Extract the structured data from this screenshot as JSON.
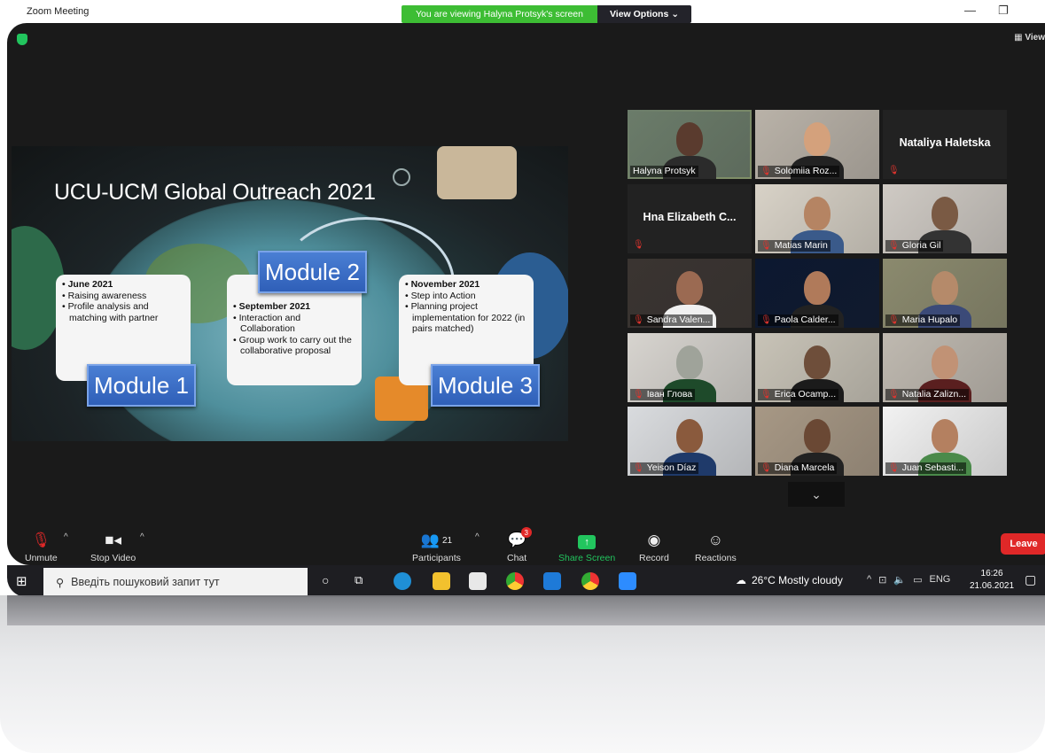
{
  "window": {
    "title": "Zoom Meeting",
    "viewing_banner": "You are viewing Halyna Protsyk's screen",
    "view_options": "View Options ⌄",
    "view_button": "View"
  },
  "slide": {
    "title": "UCU-UCM Global Outreach 2021",
    "boxes": [
      {
        "heading": "June 2021",
        "items": [
          "Raising awareness",
          "Profile analysis and matching with partner"
        ]
      },
      {
        "heading": "September 2021",
        "items": [
          "Interaction and Collaboration",
          "Group work to carry out the collaborative proposal"
        ]
      },
      {
        "heading": "November 2021",
        "items": [
          "Step into Action",
          "Planning project implementation for 2022 (in pairs matched)"
        ]
      }
    ],
    "modules": [
      "Module 1",
      "Module 2",
      "Module 3"
    ]
  },
  "participants_tiles": [
    {
      "name": "Halyna Protsyk",
      "muted": false,
      "video": true,
      "active": true
    },
    {
      "name": "Solomiia Roz...",
      "muted": true,
      "video": true
    },
    {
      "name": "Nataliya Haletska",
      "muted": true,
      "video": false
    },
    {
      "name": "Hna  Elizabeth C...",
      "muted": true,
      "video": false
    },
    {
      "name": "Matias Marin",
      "muted": true,
      "video": true
    },
    {
      "name": "Gloria Gil",
      "muted": true,
      "video": true
    },
    {
      "name": "Sandra Valen...",
      "muted": true,
      "video": true
    },
    {
      "name": "Paola Calder...",
      "muted": true,
      "video": true
    },
    {
      "name": "Maria Hupalo",
      "muted": true,
      "video": true
    },
    {
      "name": "Іван Глова",
      "muted": true,
      "video": true
    },
    {
      "name": "Erica Ocamp...",
      "muted": true,
      "video": true
    },
    {
      "name": "Natalia Zalizn...",
      "muted": true,
      "video": true
    },
    {
      "name": "Yeison Díaz",
      "muted": true,
      "video": true
    },
    {
      "name": "Diana Marcela",
      "muted": true,
      "video": true
    },
    {
      "name": "Juan Sebasti...",
      "muted": true,
      "video": true
    }
  ],
  "toolbar": {
    "unmute": "Unmute",
    "stop_video": "Stop Video",
    "participants": "Participants",
    "participants_count": "21",
    "chat": "Chat",
    "chat_badge": "3",
    "share_screen": "Share Screen",
    "record": "Record",
    "reactions": "Reactions",
    "leave": "Leave"
  },
  "taskbar": {
    "search_placeholder": "Введіть пошуковий запит тут",
    "weather": "26°C  Mostly cloudy",
    "language": "ENG",
    "time": "16:26",
    "date": "21.06.2021"
  },
  "colors": {
    "accent_green": "#3dbd34",
    "leave_red": "#e02828",
    "share_green": "#22c55e",
    "active_speaker": "#d8e05a"
  }
}
